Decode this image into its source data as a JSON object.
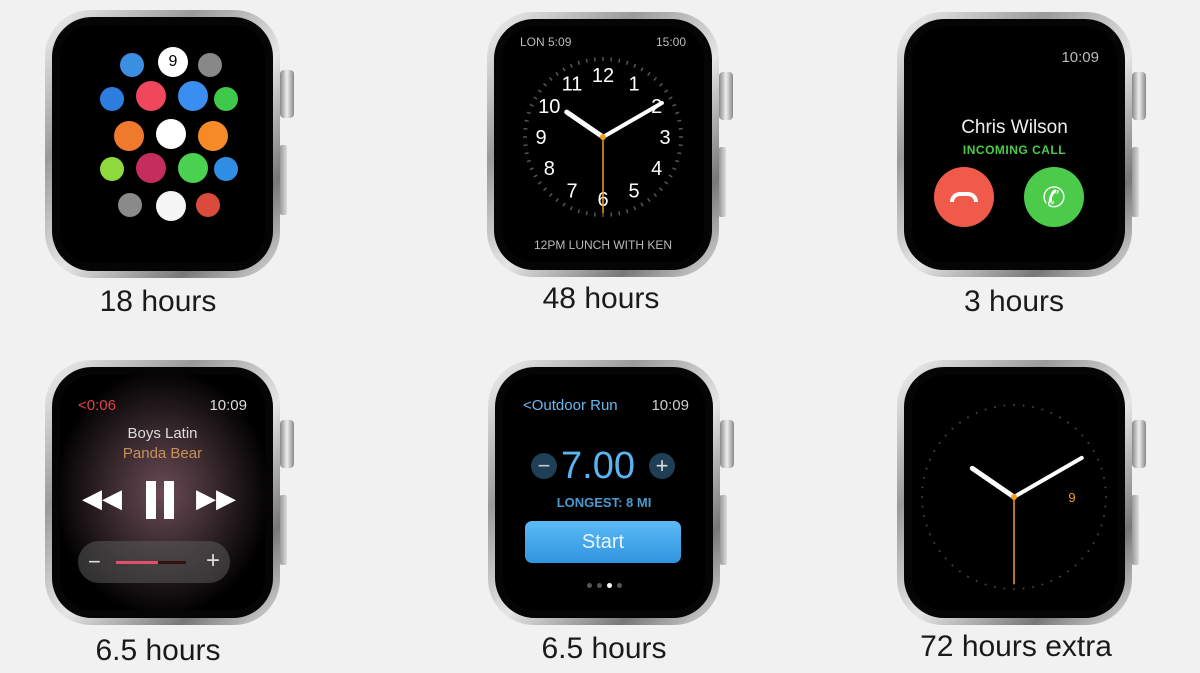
{
  "watches": [
    {
      "label": "18 hours",
      "screen": "app-grid",
      "apps": [
        {
          "name": "weather",
          "color": "#3b8fe0"
        },
        {
          "name": "calendar",
          "color": "#ffffff",
          "text": "9"
        },
        {
          "name": "photos-small",
          "color": "#888888"
        },
        {
          "name": "app-store",
          "color": "#2d7de0"
        },
        {
          "name": "music",
          "color": "#f0475c"
        },
        {
          "name": "mail",
          "color": "#3a8ef0"
        },
        {
          "name": "phone",
          "color": "#3fc94a"
        },
        {
          "name": "maps",
          "color": "#f07a2c"
        },
        {
          "name": "clock",
          "color": "#ffffff"
        },
        {
          "name": "timer",
          "color": "#f58a27"
        },
        {
          "name": "workout",
          "color": "#8ed93b"
        },
        {
          "name": "activity",
          "color": "#c42d5e"
        },
        {
          "name": "messages",
          "color": "#4ad150"
        },
        {
          "name": "remote",
          "color": "#2f8de4"
        },
        {
          "name": "settings",
          "color": "#8a8a8a"
        },
        {
          "name": "photos",
          "color": "#f5f5f5"
        },
        {
          "name": "passbook",
          "color": "#d94a3a"
        }
      ]
    },
    {
      "label": "48 hours",
      "screen": "clock",
      "top_left": "LON 5:09",
      "top_right": "15:00",
      "numerals": [
        "12",
        "1",
        "2",
        "3",
        "4",
        "5",
        "6",
        "7",
        "8",
        "9",
        "10",
        "11"
      ],
      "event": "12PM LUNCH WITH KEN",
      "hands": {
        "hour": 10.15,
        "minute": 10,
        "second": 30
      },
      "accent": "#f0a020"
    },
    {
      "label": "3 hours",
      "screen": "call",
      "time": "10:09",
      "caller": "Chris Wilson",
      "status": "INCOMING CALL",
      "decline_color": "#f05a4a",
      "accept_color": "#4ccb4a",
      "status_color": "#4ccb4a"
    },
    {
      "label": "6.5 hours",
      "screen": "music",
      "back": "<0:06",
      "time": "10:09",
      "title": "Boys Latin",
      "artist": "Panda Bear",
      "volume": 0.6,
      "minus": "−",
      "plus": "+"
    },
    {
      "label": "6.5 hours",
      "screen": "workout",
      "back": "<Outdoor Run",
      "time": "10:09",
      "value": "7.00",
      "minus": "−",
      "plus": "+",
      "longest": "LONGEST: 8 MI",
      "start": "Start",
      "page": 3,
      "pages": 4
    },
    {
      "label": "72 hours extra",
      "screen": "power-reserve",
      "numeral": "9",
      "hands": {
        "hour": 10.15,
        "minute": 10,
        "second": 30
      }
    }
  ]
}
